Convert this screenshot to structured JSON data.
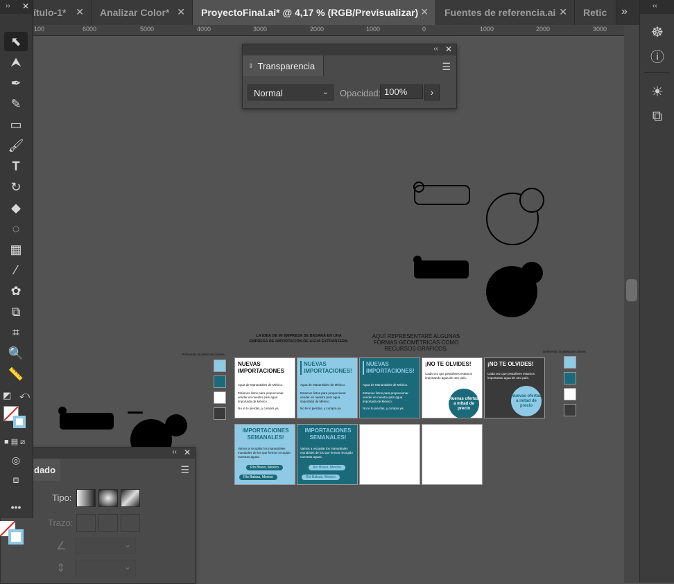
{
  "tabs": [
    {
      "label": "ítulo-1*",
      "active": false
    },
    {
      "label": "Analizar Color*",
      "active": false
    },
    {
      "label": "ProyectoFinal.ai* @ 4,17 % (RGB/Previsualizar)",
      "active": true
    },
    {
      "label": "Fuentes de referencia.ai",
      "active": false
    },
    {
      "label": "Retic",
      "active": false
    }
  ],
  "tab_close": "✕",
  "tab_overflow": "»",
  "ruler_ticks": [
    "100",
    "6000",
    "5000",
    "4000",
    "3000",
    "2000",
    "1000",
    "0",
    "1000",
    "2000",
    "3000"
  ],
  "transparency_panel": {
    "title": "Transparencia",
    "blend_mode": "Normal",
    "opacity_label": "Opacidad:",
    "opacity_value": "100%"
  },
  "gradient_panel": {
    "title": "dado",
    "type_label": "Tipo:",
    "stroke_label": "Trazo:"
  },
  "canvas_text": {
    "note_left": "LA IDEA DE MI EMPRESA SE BASARÁ EN UNA EMPRESA DE IMPORTACIÓN DE AGUA EXTRANJERA.",
    "note_right": "AQUÍ REPRESENTARÉ ALGUNAS FORMAS GEOMÉTRICAS COMO RECURSOS GRÁFICOS.",
    "palette_label": "Definiendo la paleta de colores"
  },
  "artboards": {
    "a1": {
      "title": "NUEVAS IMPORTACIONES",
      "line1": "Agua de Manantiales de México.",
      "line2": "Estamos listos para proporcionar vender en nuestro país agua importada de México.",
      "line3": "No te lo pierdas, y compra ya."
    },
    "a2": {
      "title": "NUEVAS IMPORTACIONES!",
      "line1": "Agua de Manantiales de México.",
      "line2": "Estamos listos para proporcionar vender en nuestro país agua importada de México.",
      "line3": "No te lo pierdas, y compra ya."
    },
    "a3": {
      "title": "NUEVAS IMPORTACIONES!",
      "line1": "Agua de Manantiales de México.",
      "line2": "Estamos listos para proporcionar vender en nuestro país agua importada de México.",
      "line3": "No te lo pierdas, y compra ya."
    },
    "a4": {
      "title": "¡NO TE OLVIDES!",
      "line1": "Cada vez que pestañees estamos importando agua de otro país.",
      "badge": "Nuevas ofertas a mitad de precio"
    },
    "a5": {
      "title": "¡NO TE OLVIDES!",
      "line1": "Cada vez que pestañees estamos importando agua de otro país.",
      "badge": "Nuevas ofertas a mitad de precio"
    },
    "a6": {
      "title": "IMPORTACIONES SEMANALES!",
      "line1": "Vamos a recopilar los manantiales mundiales de los que hemos recogido nuestras aguas.",
      "tag1": "Río Bravo, Mexico",
      "tag2": "Río Balsas, Mexico"
    },
    "a7": {
      "title": "IMPORTACIONES SEMANALES!",
      "line1": "Vamos a recopilar los manantiales mundiales de los que hemos recogido nuestras aguas.",
      "tag1": "Río Bravo, Mexico",
      "tag2": "Río Balsas, Mexico"
    }
  },
  "colors": {
    "light_blue": "#8ecae6",
    "teal": "#1b6a7a",
    "white": "#ffffff",
    "dark": "#3a3a3a",
    "bg": "#535353"
  }
}
